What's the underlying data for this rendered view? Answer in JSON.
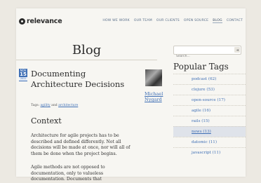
{
  "header": {
    "logo_text": "relevance",
    "nav": [
      {
        "label": "HOW WE WORK"
      },
      {
        "label": "OUR TEAM"
      },
      {
        "label": "OUR CLIENTS"
      },
      {
        "label": "OPEN SOURCE"
      },
      {
        "label": "BLOG",
        "active": true
      },
      {
        "label": "CONTACT"
      }
    ]
  },
  "search": {
    "placeholder": "Search...",
    "value": ""
  },
  "main": {
    "title": "Blog",
    "post": {
      "date": {
        "month": "NOV",
        "day": "15",
        "year": "2011"
      },
      "title": "Documenting Architecture Decisions",
      "author_first": "Michael",
      "author_last": "Nygard",
      "tags_label": "Tags:",
      "tags": [
        "agility",
        "architecture"
      ],
      "tags_conjunction": "and",
      "section_heading": "Context",
      "paragraphs": [
        "Architecture for agile projects has to be described and defined differently. Not all decisions will be made at once, nor will all of them be done when the project begins.",
        "Agile methods are not opposed to documentation, only to valueless documentation. Documents that"
      ]
    }
  },
  "sidebar": {
    "heading": "Popular Tags",
    "tags": [
      {
        "label": "podcast (62)"
      },
      {
        "label": "clojure (53)"
      },
      {
        "label": "open-source (17)"
      },
      {
        "label": "agile (16)"
      },
      {
        "label": "rails (15)"
      },
      {
        "label": "news (13)",
        "highlighted": true
      },
      {
        "label": "datomic (11)"
      },
      {
        "label": "javascript (11)"
      }
    ]
  }
}
